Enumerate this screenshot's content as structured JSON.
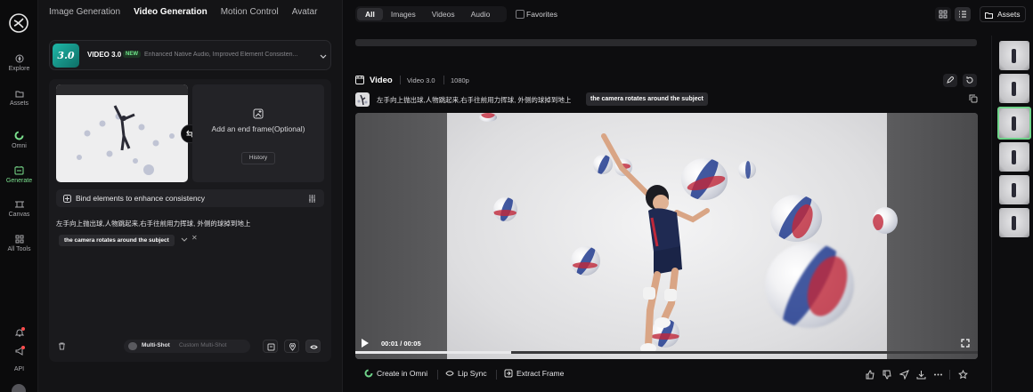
{
  "app": {
    "title": "Video Generation"
  },
  "rail": {
    "items": [
      {
        "label": "Explore",
        "icon": "compass-icon"
      },
      {
        "label": "Assets",
        "icon": "folder-icon"
      },
      {
        "label": "Omni",
        "icon": "omni-icon"
      },
      {
        "label": "Generate",
        "icon": "generate-icon",
        "active": true
      },
      {
        "label": "Canvas",
        "icon": "canvas-icon"
      },
      {
        "label": "All Tools",
        "icon": "grid-icon"
      },
      {
        "label": "API",
        "icon": "api-icon"
      }
    ]
  },
  "panel": {
    "tabs": [
      {
        "label": "Image Generation",
        "active": false
      },
      {
        "label": "Video Generation",
        "active": true
      },
      {
        "label": "Motion Control",
        "active": false
      },
      {
        "label": "Avatar",
        "active": false
      }
    ],
    "model": {
      "badge": "3.0",
      "name": "VIDEO 3.0",
      "new_label": "NEW",
      "description": "Enhanced Native Audio, Improved Element Consisten..."
    },
    "end_frame": {
      "text": "Add an end frame(Optional)",
      "history_label": "History"
    },
    "bind": {
      "label": "Bind elements to enhance consistency"
    },
    "prompt": "左手向上抛出球,人物跳起来,右手往前用力挥球, 外侧的球掉到地上",
    "tag": "the camera rotates around the subject",
    "multishot": {
      "label": "Multi-Shot",
      "sub": "Custom Multi-Shot",
      "enabled": false
    }
  },
  "main": {
    "filters": [
      {
        "label": "All",
        "active": true
      },
      {
        "label": "Images",
        "active": false
      },
      {
        "label": "Videos",
        "active": false
      },
      {
        "label": "Audio",
        "active": false
      }
    ],
    "favorites_label": "Favorites",
    "favorites_checked": false,
    "assets_label": "Assets",
    "video": {
      "title": "Video",
      "model": "Video 3.0",
      "resolution": "1080p",
      "prompt": "左手向上抛出球,人物跳起来,右手往前用力挥球, 外侧的球掉到地上",
      "tag": "the camera rotates around the subject",
      "time": "00:01 / 00:05",
      "progress": 0.25
    },
    "actions": {
      "create_in_omni": "Create in Omni",
      "lip_sync": "Lip Sync",
      "extract_frame": "Extract Frame"
    }
  },
  "colors": {
    "accent": "#6fd48a",
    "background": "#0d0d0f",
    "panel": "#141416"
  }
}
